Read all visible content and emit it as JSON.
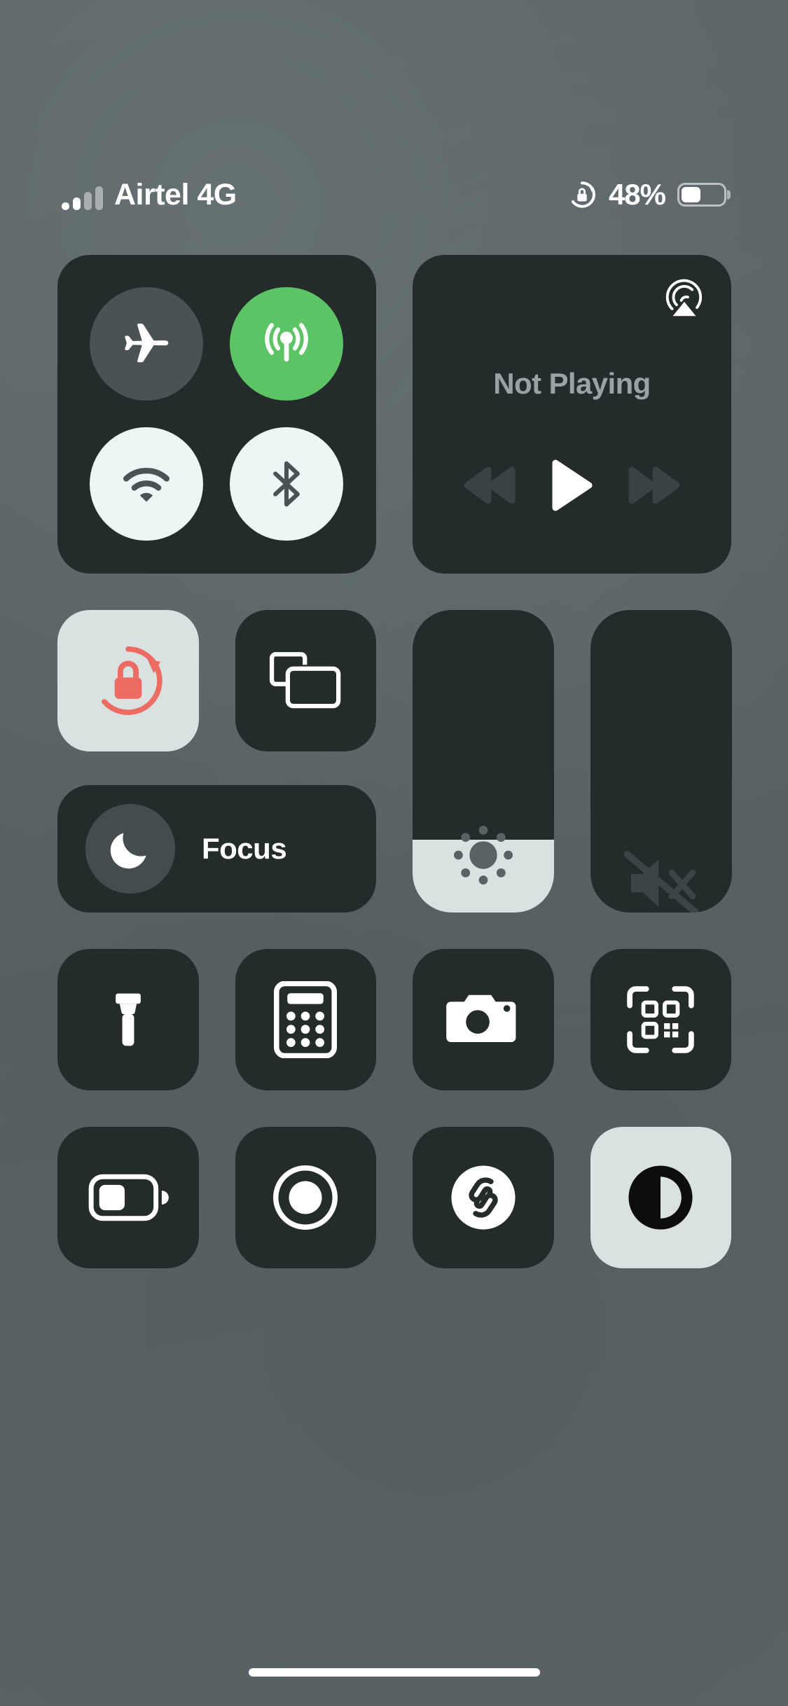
{
  "meta": {
    "screen": "ios-control-center",
    "background_color": "#596264",
    "tile_color": "#242b2b",
    "tile_active_color": "#d9e1e1",
    "accent_green": "#5dc466",
    "accent_red": "#ec6b63",
    "icon_light": "#edf5f5",
    "icon_dark": "#4a5254"
  },
  "statusbar": {
    "carrier": "Airtel 4G",
    "signal_bars_total": 4,
    "signal_bars_active": 2,
    "rotation_lock_icon": "rotation-lock-icon",
    "battery_percent_label": "48%",
    "battery_percent_value": 48
  },
  "connectivity": {
    "name": "connectivity-module",
    "toggles": [
      {
        "id": "airplane-mode",
        "label": "Airplane Mode",
        "icon": "airplane-icon",
        "state": "off"
      },
      {
        "id": "cellular-data",
        "label": "Cellular Data",
        "icon": "cellular-antenna-icon",
        "state": "on"
      },
      {
        "id": "wifi",
        "label": "Wi-Fi",
        "icon": "wifi-icon",
        "state": "on"
      },
      {
        "id": "bluetooth",
        "label": "Bluetooth",
        "icon": "bluetooth-icon",
        "state": "on"
      }
    ]
  },
  "media": {
    "name": "now-playing-module",
    "title": "Not Playing",
    "airplay_icon": "airplay-icon",
    "controls": [
      {
        "id": "rewind",
        "label": "Rewind",
        "icon": "rewind-icon",
        "enabled": false
      },
      {
        "id": "play",
        "label": "Play",
        "icon": "play-icon",
        "enabled": true
      },
      {
        "id": "forward",
        "label": "Fast Forward",
        "icon": "fast-forward-icon",
        "enabled": false
      }
    ]
  },
  "toggles": {
    "rotation_lock": {
      "label": "Rotation Lock",
      "icon": "rotation-lock-icon",
      "state": "on"
    },
    "screen_mirroring": {
      "label": "Screen Mirroring",
      "icon": "screen-mirroring-icon",
      "state": "off"
    },
    "focus": {
      "label": "Focus",
      "icon": "moon-icon",
      "state": "off"
    }
  },
  "sliders": {
    "brightness": {
      "label": "Brightness",
      "icon": "brightness-icon",
      "value": 24
    },
    "volume": {
      "label": "Volume",
      "icon": "volume-mute-icon",
      "value": 0,
      "muted": true
    }
  },
  "shortcuts_row_1": [
    {
      "id": "flashlight",
      "label": "Flashlight",
      "icon": "flashlight-icon",
      "state": "off"
    },
    {
      "id": "calculator",
      "label": "Calculator",
      "icon": "calculator-icon",
      "state": "off"
    },
    {
      "id": "camera",
      "label": "Camera",
      "icon": "camera-icon",
      "state": "off"
    },
    {
      "id": "qr-scanner",
      "label": "Code Scanner",
      "icon": "qr-code-icon",
      "state": "off"
    }
  ],
  "shortcuts_row_2": [
    {
      "id": "low-power-mode",
      "label": "Low Power Mode",
      "icon": "battery-icon",
      "state": "off"
    },
    {
      "id": "screen-recording",
      "label": "Screen Recording",
      "icon": "record-icon",
      "state": "off"
    },
    {
      "id": "shazam",
      "label": "Music Recognition",
      "icon": "shazam-icon",
      "state": "off"
    },
    {
      "id": "dark-mode",
      "label": "Dark Mode",
      "icon": "dark-mode-icon",
      "state": "on"
    }
  ],
  "home_indicator": {
    "label": "Home Indicator"
  }
}
